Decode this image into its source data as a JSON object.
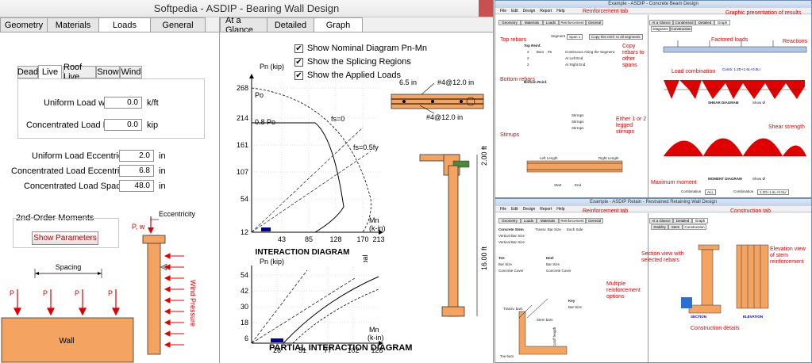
{
  "main": {
    "title": "Softpedia - ASDIP - Bearing Wall Design",
    "left_tabs": [
      "Geometry",
      "Materials",
      "Loads",
      "General"
    ],
    "active_left_tab": "Loads",
    "right_tabs": [
      "At a Glance",
      "Detailed",
      "Graph"
    ],
    "active_right_tab": "Graph",
    "load_tabs": [
      "Dead",
      "Live",
      "Roof Live",
      "Snow",
      "Wind"
    ],
    "active_load_tab": "Live",
    "uniform_load": {
      "label": "Uniform Load  w",
      "value": "0.0",
      "unit": "k/ft"
    },
    "concentrated_load": {
      "label": "Concentrated Load  P",
      "value": "0.0",
      "unit": "kip"
    },
    "uniform_ecc": {
      "label": "Uniform Load Eccentricity",
      "value": "2.0",
      "unit": "in"
    },
    "conc_ecc": {
      "label": "Concentrated Load Eccentricity",
      "value": "6.8",
      "unit": "in"
    },
    "conc_spacing": {
      "label": "Concentrated Load Spacing",
      "value": "48.0",
      "unit": "in"
    },
    "second_order": {
      "label": "2nd-Order Moments",
      "button": "Show Parameters"
    },
    "diagram": {
      "spacing": "Spacing",
      "p": "P",
      "wall": "Wall",
      "eccentricity": "Eccentricity",
      "pw": "P, w",
      "wind": "Wind Pressure"
    },
    "graph": {
      "checks": [
        {
          "label": "Show Nominal Diagram Pn-Mn",
          "checked": true
        },
        {
          "label": "Show the Splicing Regions",
          "checked": true
        },
        {
          "label": "Show the Applied Loads",
          "checked": true
        }
      ],
      "interaction_title": "INTERACTION DIAGRAM",
      "partial_title": "PARTIAL INTERACTION DIAGRAM",
      "y_label": "Pn (kip)",
      "x_label_1": "Mn",
      "x_label_2": "(k-in)",
      "y_ticks_1": [
        "268",
        "214",
        "161",
        "107",
        "54",
        "12"
      ],
      "x_ticks_1": [
        "43",
        "85",
        "128",
        "170",
        "213"
      ],
      "y_ticks_2": [
        "54",
        "42",
        "30",
        "18",
        "6"
      ],
      "x_ticks_2": [
        "26",
        "51",
        "77",
        "102",
        "128"
      ],
      "annotations": {
        "po": "Po",
        "po08": "0.8 Po",
        "fs0": "fs=0",
        "fs05": "fs=0.5fy",
        "mbal": "Mbal"
      },
      "section": {
        "width": "6.5 in",
        "rebar_top": "#4@12.0 in",
        "rebar_bot": "#4@12.0 in",
        "h1": "2.00 ft",
        "h2": "16.00 ft"
      }
    }
  },
  "beam_window": {
    "title": "Example - ASDIP - Concrete Beam Design",
    "menu": [
      "File",
      "Edit",
      "Design",
      "Report",
      "Help"
    ],
    "annotations": {
      "reinf_tab": "Reinforcement tab",
      "graphic": "Graphic presentation of results",
      "top_rebars": "Top rebars",
      "copy_rebars": "Copy rebars to other spans",
      "factored": "Factored loads",
      "reactions": "Reactions",
      "bottom_rebars": "Bottom rebars",
      "load_combo": "Load combination",
      "stirrups": "Stirrups",
      "legged": "Either 1 or 2 legged stirrups",
      "shear_strength": "Shear strength",
      "max_moment": "Maximum moment"
    },
    "tabs": [
      "Geometry",
      "Materials",
      "Loads",
      "Reinforcement",
      "General",
      "At a Glance",
      "Condensed",
      "Detailed",
      "Graph"
    ],
    "diagram_tabs": [
      "Diagrams",
      "Construction"
    ],
    "segment_label": "Segment",
    "segment_value": "Span 1",
    "copy_button": "Copy this reinf. to all segments",
    "top_bars": "Top Reinf.",
    "bottom_bars": "Bottom Reinf.",
    "rebar_rows": [
      {
        "count": "2",
        "bars": "Bars",
        "size": "#6",
        "at": "Continuous Along the Segment",
        "cover": "2.0"
      },
      {
        "count": "2",
        "bars": "Bars",
        "size": "#6",
        "at": "At Left End",
        "cover": "2.0"
      },
      {
        "count": "2",
        "bars": "Bars",
        "size": "#6",
        "at": "At Right End",
        "cover": "2.0"
      }
    ],
    "shear_diagram": "SHEAR DIAGRAM",
    "moment_diagram": "MOMENT DIAGRAM",
    "show_phi": "Show Ø",
    "combination_label": "Combination",
    "combination_value": "1.2D+1.6L+0.5Lr",
    "combo_note": "Comb: 1.2D+1.6L+0.5Lr",
    "stirrup_rows": [
      "Stirrups",
      "Stirrups",
      "Stirrups"
    ],
    "left_length": "Left Length",
    "right_length": "Right Length",
    "start": "Start",
    "end": "End",
    "segment_dropdown": "ALL"
  },
  "wall_window": {
    "title": "Example - ASDIP Retain - Restrained Retaining Wall Design",
    "menu": [
      "File",
      "Edit",
      "Design",
      "Report",
      "Help"
    ],
    "annotations": {
      "reinf_tab": "Reinforcement tab",
      "construction_tab": "Construction tab",
      "section_view": "Section view with selected rebars",
      "elevation_view": "Elevation view of stem reinforcement",
      "multiple": "Multiple reinforcement options",
      "construction": "Construction details"
    },
    "tabs": [
      "Geometry",
      "Loads",
      "Materials",
      "Reinforcement",
      "General",
      "At a Glance",
      "Detailed",
      "Graph"
    ],
    "sub_tabs": [
      "Stability",
      "Stem",
      "Construction"
    ],
    "section_label": "SECTION",
    "elevation_label": "ELEVATION",
    "concrete_stem": "Concrete Stem",
    "toe": "Toe",
    "heel": "Heel",
    "key": "Key",
    "vertical_bar": "Vertical Bar Size",
    "transv_bar": "Transv. Bar Size",
    "bar_size": "Bar Size",
    "concrete_cover": "Concrete Cover",
    "each_side": "Each Side",
    "transv_bars": "Transv. bars",
    "stem_bars": "Stem bars",
    "toe_bars": "Toe bars",
    "cutoff": "Cutoff length"
  }
}
